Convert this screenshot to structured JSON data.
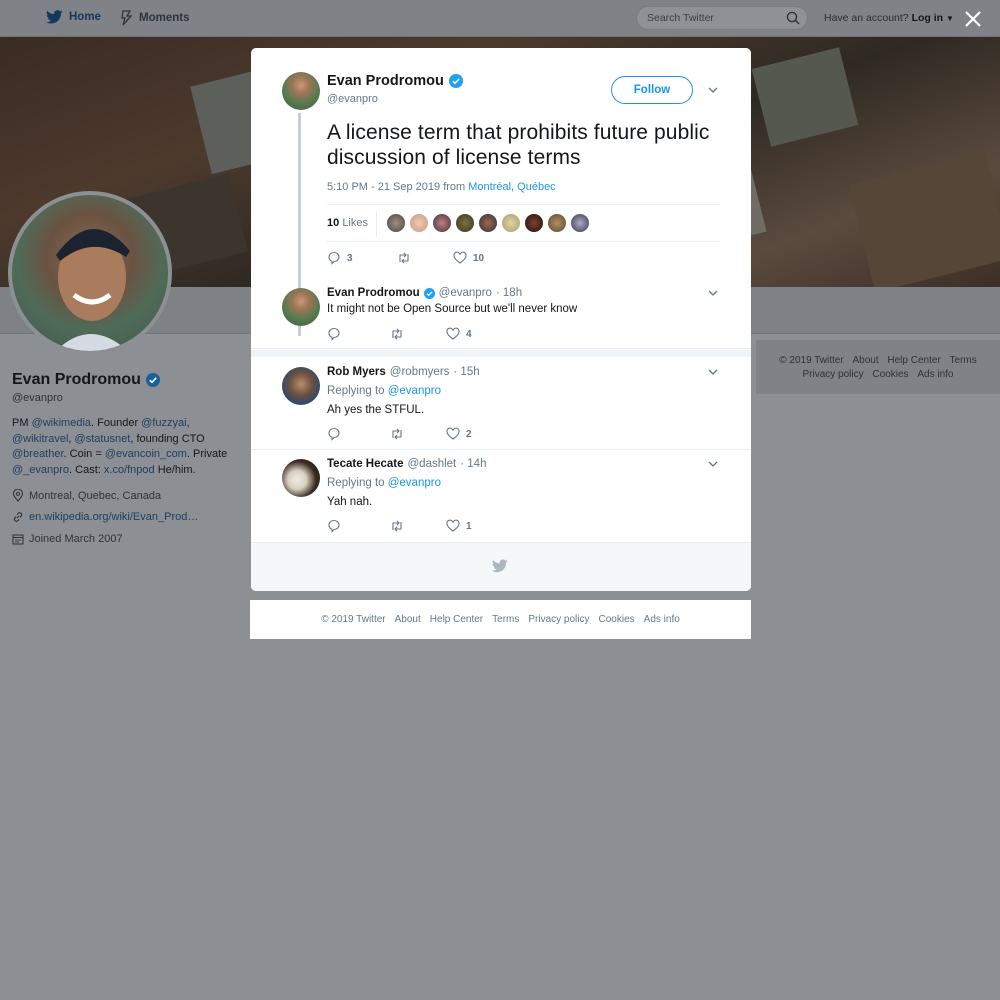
{
  "nav": {
    "home_label": "Home",
    "moments_label": "Moments",
    "search_placeholder": "Search Twitter",
    "have_account": "Have an account?",
    "login_label": "Log in"
  },
  "profile": {
    "name": "Evan Prodromou",
    "handle": "@evanpro",
    "bio": {
      "t1": "PM ",
      "l1": "@wikimedia",
      "t2": ". Founder ",
      "l2": "@fuzzyai",
      "t3": ",",
      "l3": "@wikitravel",
      "t4": ", ",
      "l4": "@statusnet",
      "t5": ", founding CTO",
      "l5": "@breather",
      "t6": ". Coin = ",
      "l6": "@evancoin_com",
      "t7": ". Private",
      "l7": "@_evanpro",
      "t8": ". Cast: ",
      "l8": "x.co/fnpod",
      "t9": " He/him."
    },
    "location": "Montreal, Quebec, Canada",
    "website": "en.wikipedia.org/wiki/Evan_Prod…",
    "joined": "Joined March 2007"
  },
  "side_footer": {
    "row1": [
      "© 2019 Twitter",
      "About",
      "Help Center",
      "Terms"
    ],
    "row2": [
      "Privacy policy",
      "Cookies",
      "Ads info"
    ]
  },
  "tweet": {
    "author_name": "Evan Prodromou",
    "author_handle": "@evanpro",
    "follow_label": "Follow",
    "text": "A license term that prohibits future public discussion of license terms",
    "time": "5:10 PM - 21 Sep 2019 from ",
    "location": "Montréal, Québec",
    "likes_number": "10",
    "likes_word": "Likes",
    "replies": "3",
    "retweets": "",
    "likes": "10"
  },
  "replies": [
    {
      "name": "Evan Prodromou",
      "handle": "@evanpro",
      "time": "· 18h",
      "replying_to": "",
      "text": "It might not be Open Source but we'll never know",
      "reply_count": "",
      "like_count": "4"
    },
    {
      "name": "Rob Myers",
      "handle": "@robmyers",
      "time": "· 15h",
      "replying_prefix": "Replying to ",
      "replying_to": "@evanpro",
      "text": "Ah yes the STFUL.",
      "reply_count": "",
      "like_count": "2"
    },
    {
      "name": "Tecate Hecate",
      "handle": "@dashlet",
      "time": "· 14h",
      "replying_prefix": "Replying to ",
      "replying_to": "@evanpro",
      "text": "Yah nah.",
      "reply_count": "",
      "like_count": "1"
    }
  ],
  "lower_footer": [
    "© 2019 Twitter",
    "About",
    "Help Center",
    "Terms",
    "Privacy policy",
    "Cookies",
    "Ads info"
  ],
  "colors": {
    "twitter_blue": "#1b95e0",
    "verified": "#1da1f2",
    "text_gray": "#657786"
  }
}
